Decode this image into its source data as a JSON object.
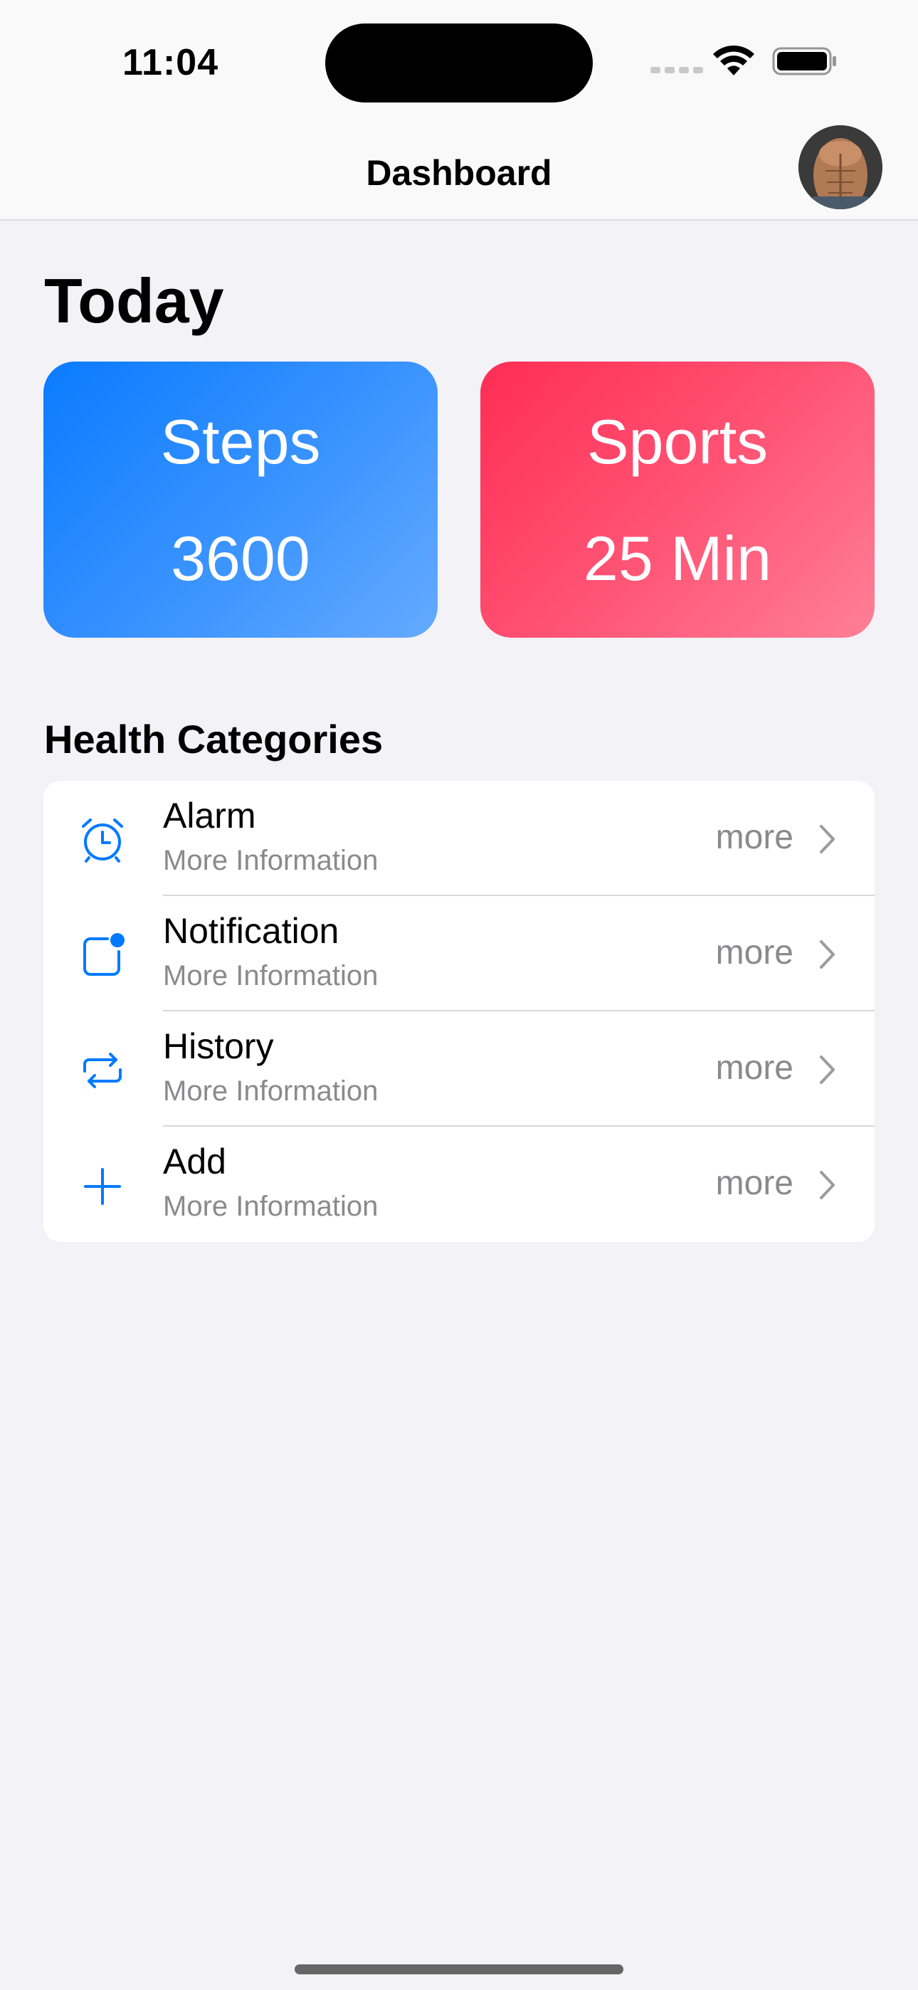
{
  "status_bar": {
    "time": "11:04"
  },
  "nav": {
    "title": "Dashboard",
    "avatar_icon": "profile-avatar"
  },
  "today": {
    "title": "Today",
    "cards": [
      {
        "label": "Steps",
        "value": "3600",
        "color": "#0a7bff"
      },
      {
        "label": "Sports",
        "value": "25 Min",
        "color": "#ff2d55"
      }
    ]
  },
  "health": {
    "title": "Health Categories",
    "items": [
      {
        "title": "Alarm",
        "subtitle": "More Information",
        "action": "more",
        "icon": "alarm-icon"
      },
      {
        "title": "Notification",
        "subtitle": "More Information",
        "action": "more",
        "icon": "notification-icon"
      },
      {
        "title": "History",
        "subtitle": "More Information",
        "action": "more",
        "icon": "history-icon"
      },
      {
        "title": "Add",
        "subtitle": "More Information",
        "action": "more",
        "icon": "add-icon"
      }
    ]
  },
  "colors": {
    "accent": "#007aff",
    "background": "#f2f2f7",
    "secondary_text": "#8a8a8e"
  }
}
